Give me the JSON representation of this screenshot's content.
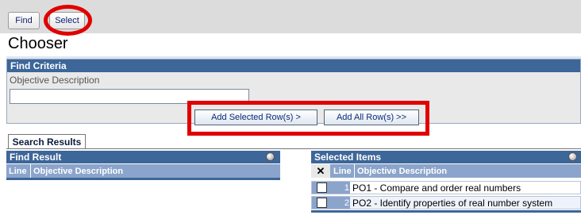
{
  "toolbar": {
    "find_label": "Find",
    "select_label": "Select"
  },
  "page_title": "Chooser",
  "find_criteria": {
    "header": "Find Criteria",
    "field_label": "Objective Description",
    "field_value": ""
  },
  "actions": {
    "add_selected_label": "Add Selected Row(s) >",
    "add_all_label": "Add All Row(s) >>"
  },
  "tabs": {
    "search_results": "Search Results"
  },
  "find_result": {
    "header": "Find Result",
    "col_line": "Line",
    "col_desc": "Objective Description"
  },
  "selected_items": {
    "header": "Selected Items",
    "col_x": "✕",
    "col_line": "Line",
    "col_desc": "Objective Description",
    "rows": [
      {
        "line": "1",
        "desc": "PO1 - Compare and order real numbers"
      },
      {
        "line": "2",
        "desc": "PO2 - Identify properties of real number system"
      }
    ]
  },
  "colors": {
    "header_blue": "#3d6699",
    "column_blue": "#8ba4cb",
    "highlight_red": "#e00000"
  }
}
